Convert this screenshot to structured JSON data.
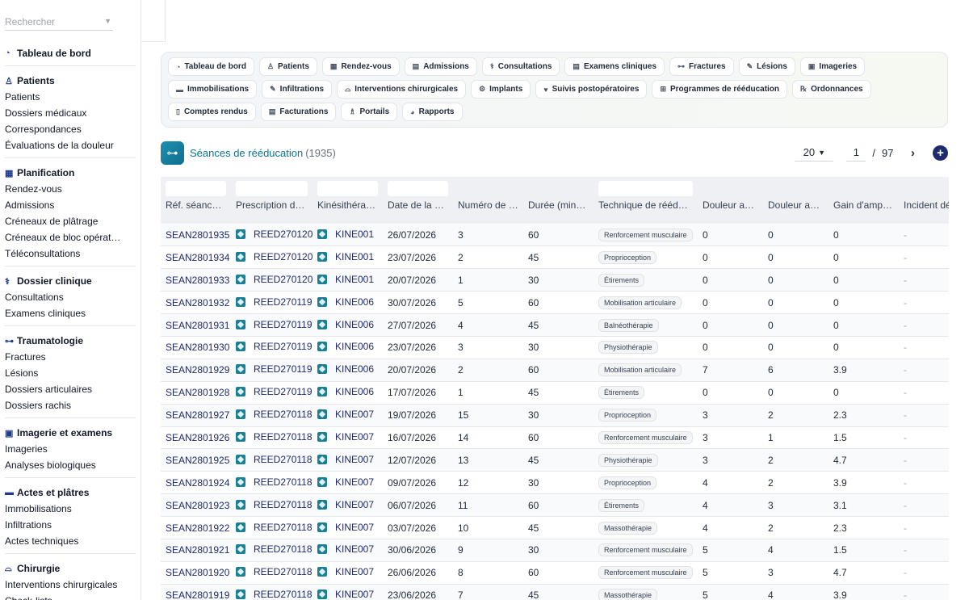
{
  "sidebar": {
    "search_placeholder": "Rechercher",
    "sections": [
      {
        "icon": "gauge-icon",
        "glyph": "◔",
        "heading": "Tableau de bord",
        "items": []
      },
      {
        "icon": "user-icon",
        "glyph": "♙",
        "heading": "Patients",
        "items": [
          "Patients",
          "Dossiers médicaux",
          "Correspondances",
          "Évaluations de la douleur"
        ]
      },
      {
        "icon": "calendar-icon",
        "glyph": "▦",
        "heading": "Planification",
        "items": [
          "Rendez-vous",
          "Admissions",
          "Créneaux de plâtrage",
          "Créneaux de bloc opérat…",
          "Téléconsultations"
        ]
      },
      {
        "icon": "stethoscope-icon",
        "glyph": "⚕",
        "heading": "Dossier clinique",
        "items": [
          "Consultations",
          "Examens cliniques"
        ]
      },
      {
        "icon": "bone-icon",
        "glyph": "⊶",
        "heading": "Traumatologie",
        "items": [
          "Fractures",
          "Lésions",
          "Dossiers articulaires",
          "Dossiers rachis"
        ]
      },
      {
        "icon": "xray-icon",
        "glyph": "▣",
        "heading": "Imagerie et examens",
        "items": [
          "Imageries",
          "Analyses biologiques"
        ]
      },
      {
        "icon": "cast-icon",
        "glyph": "▬",
        "heading": "Actes et plâtres",
        "items": [
          "Immobilisations",
          "Infiltrations",
          "Actes techniques"
        ]
      },
      {
        "icon": "bed-icon",
        "glyph": "⌓",
        "heading": "Chirurgie",
        "items": [
          "Interventions chirurgicales",
          "Check-lists"
        ]
      }
    ]
  },
  "pills": [
    {
      "icon": "gauge-icon",
      "glyph": "◔",
      "label": "Tableau de bord"
    },
    {
      "icon": "user-icon",
      "glyph": "♙",
      "label": "Patients"
    },
    {
      "icon": "calendar-icon",
      "glyph": "▦",
      "label": "Rendez-vous"
    },
    {
      "icon": "clipboard-icon",
      "glyph": "▤",
      "label": "Admissions"
    },
    {
      "icon": "stethoscope-icon",
      "glyph": "⚕",
      "label": "Consultations"
    },
    {
      "icon": "clipboard-check-icon",
      "glyph": "▤",
      "label": "Examens cliniques"
    },
    {
      "icon": "bone-icon",
      "glyph": "⊶",
      "label": "Fractures"
    },
    {
      "icon": "bandage-icon",
      "glyph": "✎",
      "label": "Lésions"
    },
    {
      "icon": "xray-icon",
      "glyph": "▣",
      "label": "Imageries"
    },
    {
      "icon": "cast-icon",
      "glyph": "▬",
      "label": "Immobilisations"
    },
    {
      "icon": "syringe-icon",
      "glyph": "✎",
      "label": "Infiltrations"
    },
    {
      "icon": "bed-icon",
      "glyph": "⌓",
      "label": "Interventions chirurgicales"
    },
    {
      "icon": "gears-icon",
      "glyph": "⚙",
      "label": "Implants"
    },
    {
      "icon": "heart-icon",
      "glyph": "♥",
      "label": "Suivis postopératoires"
    },
    {
      "icon": "dumbbell-icon",
      "glyph": "⊞",
      "label": "Programmes de rééducation"
    },
    {
      "icon": "prescription-icon",
      "glyph": "℞",
      "label": "Ordonnances"
    },
    {
      "icon": "file-icon",
      "glyph": "▯",
      "label": "Comptes rendus"
    },
    {
      "icon": "invoice-icon",
      "glyph": "▤",
      "label": "Facturations"
    },
    {
      "icon": "users-icon",
      "glyph": "♗",
      "label": "Portails"
    },
    {
      "icon": "chart-pie-icon",
      "glyph": "◕",
      "label": "Rapports"
    }
  ],
  "page": {
    "title": "Séances de rééducation",
    "count": "(1935)",
    "per_page": "20",
    "current_page": "1",
    "separator": "/",
    "total_pages": "97",
    "next_glyph": "›",
    "add_glyph": "+"
  },
  "table": {
    "columns": [
      "Réf. séance …",
      "Prescription de …",
      "Kinésithérap…",
      "Date de la s…",
      "Numéro de s…",
      "Durée (minut…",
      "Technique de rééduc…",
      "Douleur avant",
      "Douleur après",
      "Gain d'ampli…",
      "Incident dé…"
    ],
    "rows": [
      [
        "SEAN2801935",
        "REED270120",
        "KINE001",
        "26/07/2026",
        "3",
        "60",
        "Renforcement musculaire",
        "0",
        "0",
        "0",
        "-"
      ],
      [
        "SEAN2801934",
        "REED270120",
        "KINE001",
        "23/07/2026",
        "2",
        "45",
        "Proprioception",
        "0",
        "0",
        "0",
        "-"
      ],
      [
        "SEAN2801933",
        "REED270120",
        "KINE001",
        "20/07/2026",
        "1",
        "30",
        "Étirements",
        "0",
        "0",
        "0",
        "-"
      ],
      [
        "SEAN2801932",
        "REED270119",
        "KINE006",
        "30/07/2026",
        "5",
        "60",
        "Mobilisation articulaire",
        "0",
        "0",
        "0",
        "-"
      ],
      [
        "SEAN2801931",
        "REED270119",
        "KINE006",
        "27/07/2026",
        "4",
        "45",
        "Balnéothérapie",
        "0",
        "0",
        "0",
        "-"
      ],
      [
        "SEAN2801930",
        "REED270119",
        "KINE006",
        "23/07/2026",
        "3",
        "30",
        "Physiothérapie",
        "0",
        "0",
        "0",
        "-"
      ],
      [
        "SEAN2801929",
        "REED270119",
        "KINE006",
        "20/07/2026",
        "2",
        "60",
        "Mobilisation articulaire",
        "7",
        "6",
        "3.9",
        "-"
      ],
      [
        "SEAN2801928",
        "REED270119",
        "KINE006",
        "17/07/2026",
        "1",
        "45",
        "Étirements",
        "0",
        "0",
        "0",
        "-"
      ],
      [
        "SEAN2801927",
        "REED270118",
        "KINE007",
        "19/07/2026",
        "15",
        "30",
        "Proprioception",
        "3",
        "2",
        "2.3",
        "-"
      ],
      [
        "SEAN2801926",
        "REED270118",
        "KINE007",
        "16/07/2026",
        "14",
        "60",
        "Renforcement musculaire",
        "3",
        "1",
        "1.5",
        "-"
      ],
      [
        "SEAN2801925",
        "REED270118",
        "KINE007",
        "12/07/2026",
        "13",
        "45",
        "Physiothérapie",
        "3",
        "2",
        "4.7",
        "-"
      ],
      [
        "SEAN2801924",
        "REED270118",
        "KINE007",
        "09/07/2026",
        "12",
        "30",
        "Proprioception",
        "4",
        "2",
        "3.9",
        "-"
      ],
      [
        "SEAN2801923",
        "REED270118",
        "KINE007",
        "06/07/2026",
        "11",
        "60",
        "Étirements",
        "4",
        "3",
        "3.1",
        "-"
      ],
      [
        "SEAN2801922",
        "REED270118",
        "KINE007",
        "03/07/2026",
        "10",
        "45",
        "Massothérapie",
        "4",
        "2",
        "2.3",
        "-"
      ],
      [
        "SEAN2801921",
        "REED270118",
        "KINE007",
        "30/06/2026",
        "9",
        "30",
        "Renforcement musculaire",
        "5",
        "4",
        "1.5",
        "-"
      ],
      [
        "SEAN2801920",
        "REED270118",
        "KINE007",
        "26/06/2026",
        "8",
        "60",
        "Renforcement musculaire",
        "5",
        "3",
        "4.7",
        "-"
      ],
      [
        "SEAN2801919",
        "REED270118",
        "KINE007",
        "23/06/2026",
        "7",
        "45",
        "Massothérapie",
        "5",
        "4",
        "3.9",
        "-"
      ]
    ]
  }
}
